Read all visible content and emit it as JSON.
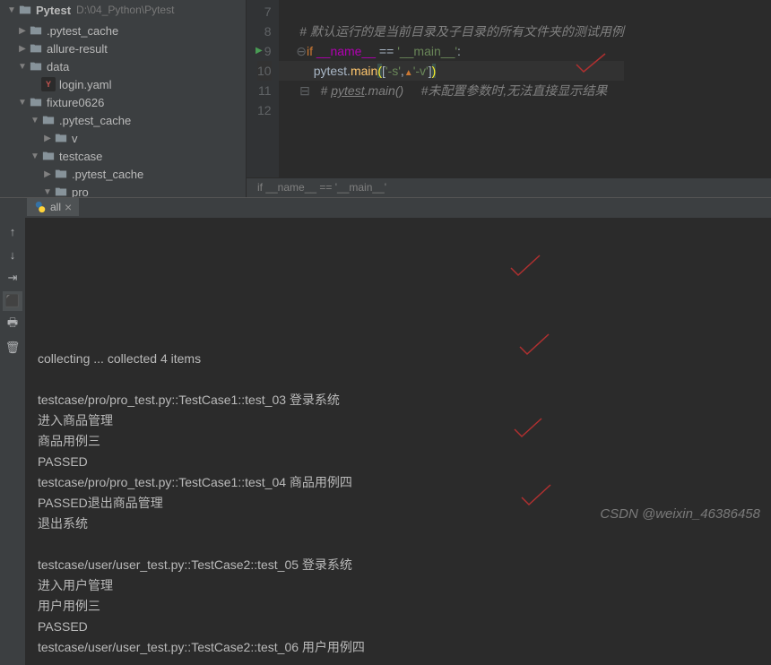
{
  "project": {
    "name": "Pytest",
    "path": "D:\\04_Python\\Pytest"
  },
  "tree": [
    {
      "indent": 1,
      "arrow": "▶",
      "icon": "folder",
      "label": ".pytest_cache"
    },
    {
      "indent": 1,
      "arrow": "▶",
      "icon": "folder",
      "label": "allure-result"
    },
    {
      "indent": 1,
      "arrow": "▼",
      "icon": "folder",
      "label": "data"
    },
    {
      "indent": 2,
      "arrow": "",
      "icon": "yaml",
      "label": "login.yaml"
    },
    {
      "indent": 1,
      "arrow": "▼",
      "icon": "folder",
      "label": "fixture0626"
    },
    {
      "indent": 2,
      "arrow": "▼",
      "icon": "folder",
      "label": ".pytest_cache"
    },
    {
      "indent": 3,
      "arrow": "▶",
      "icon": "folder",
      "label": "v"
    },
    {
      "indent": 2,
      "arrow": "▼",
      "icon": "folder",
      "label": "testcase"
    },
    {
      "indent": 3,
      "arrow": "▶",
      "icon": "folder",
      "label": ".pytest_cache"
    },
    {
      "indent": 3,
      "arrow": "▼",
      "icon": "folder",
      "label": "pro"
    }
  ],
  "code": {
    "lines": [
      "7",
      "8",
      "9",
      "10",
      "11",
      "12"
    ],
    "comment_8": "# 默认运行的是当前目录及子目录的所有文件夹的测试用例",
    "kw_if": "if",
    "name_var": "__name__",
    "eq": " == ",
    "main_str": "'__main__'",
    "colon": ":",
    "pytest_call": "pytest.",
    "main_fn": "main",
    "arg_s": "'-s'",
    "arg_v": "'-v'",
    "comma": ",",
    "comment_11a": "# ",
    "comment_11b": "pytest",
    "comment_11c": ".main()",
    "comment_11d": "     #未配置参数时,无法直接显示结果"
  },
  "breadcrumb": "if __name__ == '__main__'",
  "runTab": "all",
  "output_lines": [
    "collecting ... collected 4 items",
    "",
    "testcase/pro/pro_test.py::TestCase1::test_03 登录系统",
    "进入商品管理",
    "商品用例三",
    "PASSED",
    "testcase/pro/pro_test.py::TestCase1::test_04 商品用例四",
    "PASSED退出商品管理",
    "退出系统",
    "",
    "testcase/user/user_test.py::TestCase2::test_05 登录系统",
    "进入用户管理",
    "用户用例三",
    "PASSED",
    "testcase/user/user_test.py::TestCase2::test_06 用户用例四"
  ],
  "watermark": "CSDN @weixin_46386458"
}
